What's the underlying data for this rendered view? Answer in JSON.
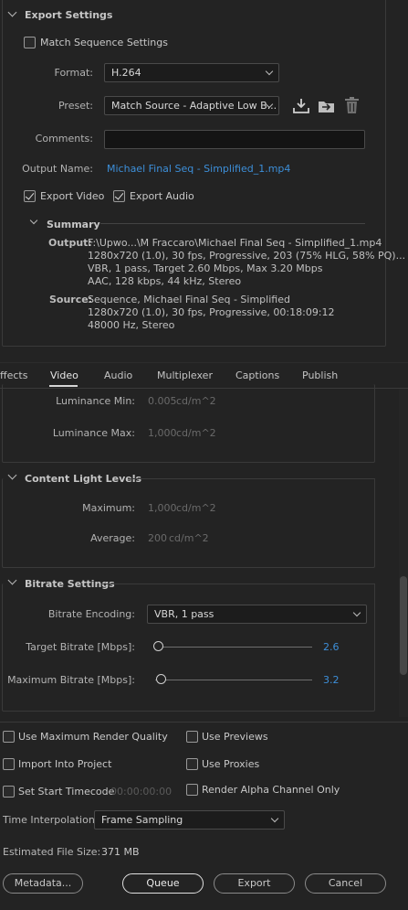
{
  "export_settings": {
    "title": "Export Settings",
    "match_sequence_label": "Match Sequence Settings",
    "format_label": "Format:",
    "format_value": "H.264",
    "preset_label": "Preset:",
    "preset_value": "Match Source - Adaptive Low B...",
    "comments_label": "Comments:",
    "comments_value": "",
    "output_name_label": "Output Name:",
    "output_name_value": "Michael Final Seq  - Simplified_1.mp4",
    "export_video_label": "Export Video",
    "export_audio_label": "Export Audio",
    "export_video_checked": true,
    "export_audio_checked": true,
    "summary": {
      "title": "Summary",
      "output_label": "Output:",
      "output_lines": [
        "F:\\Upwo...\\M Fraccaro\\Michael Final Seq  - Simplified_1.mp4",
        "1280x720 (1.0), 30 fps, Progressive, 203 (75% HLG, 58% PQ)...",
        "VBR, 1 pass, Target 2.60 Mbps, Max 3.20 Mbps",
        "AAC, 128 kbps, 44 kHz, Stereo"
      ],
      "source_label": "Source:",
      "source_lines": [
        "Sequence, Michael Final Seq  - Simplified",
        "1280x720 (1.0), 30 fps, Progressive, 00:18:09:12",
        "48000 Hz, Stereo"
      ]
    }
  },
  "tabs": [
    {
      "label": "ffects",
      "active": false
    },
    {
      "label": "Video",
      "active": true
    },
    {
      "label": "Audio",
      "active": false
    },
    {
      "label": "Multiplexer",
      "active": false
    },
    {
      "label": "Captions",
      "active": false
    },
    {
      "label": "Publish",
      "active": false
    }
  ],
  "luminance": {
    "min_label": "Luminance Min:",
    "min_value": "0.005",
    "min_unit": "cd/m^2",
    "max_label": "Luminance Max:",
    "max_value": "1,000",
    "max_unit": "cd/m^2"
  },
  "content_light": {
    "title": "Content Light Levels",
    "maximum_label": "Maximum:",
    "maximum_value": "1,000",
    "maximum_unit": "cd/m^2",
    "average_label": "Average:",
    "average_value": "200",
    "average_unit": "cd/m^2"
  },
  "bitrate": {
    "title": "Bitrate Settings",
    "encoding_label": "Bitrate Encoding:",
    "encoding_value": "VBR, 1 pass",
    "target_label": "Target Bitrate [Mbps]:",
    "target_value": "2.6",
    "max_label": "Maximum Bitrate [Mbps]:",
    "max_value": "3.2"
  },
  "options": {
    "max_render_quality": "Use Maximum Render Quality",
    "use_previews": "Use Previews",
    "import_into_project": "Import Into Project",
    "use_proxies": "Use Proxies",
    "set_start_timecode": "Set Start Timecode",
    "start_timecode_value": "00:00:00:00",
    "render_alpha": "Render Alpha Channel Only"
  },
  "time_interpolation": {
    "label": "Time Interpolation:",
    "value": "Frame Sampling"
  },
  "file_size": {
    "label": "Estimated File Size:",
    "value": "371 MB"
  },
  "buttons": {
    "metadata": "Metadata...",
    "queue": "Queue",
    "export": "Export",
    "cancel": "Cancel"
  },
  "colors": {
    "background": "#232323",
    "accent_blue": "#3d8fd9",
    "dim_text": "#6a6a6a"
  },
  "icons": [
    "save-preset-icon",
    "import-preset-icon",
    "delete-preset-icon",
    "chevron-down-icon"
  ]
}
